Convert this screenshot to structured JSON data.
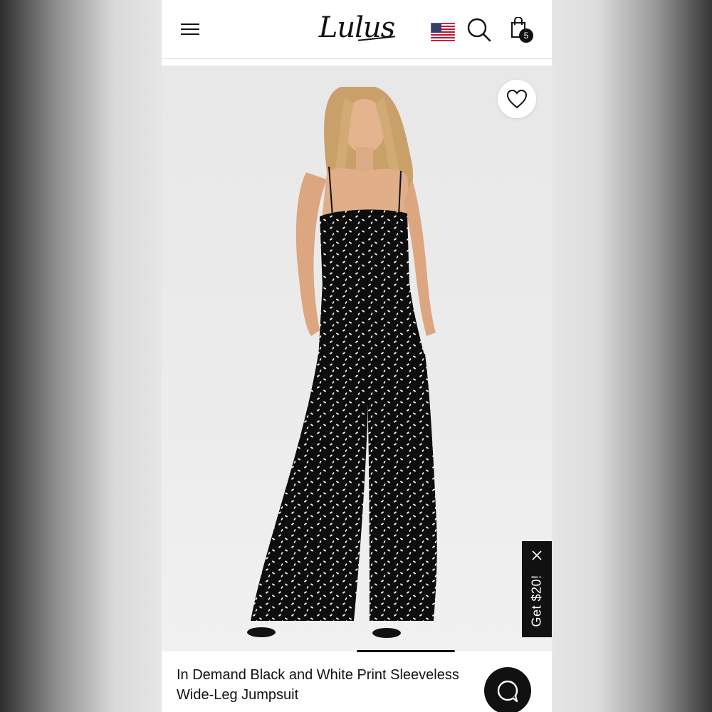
{
  "header": {
    "brand": "Lulus",
    "cart_count": "5"
  },
  "product": {
    "title_line1": "In Demand Black and White Print Sleeveless",
    "title_line2": "Wide-Leg Jumpsuit"
  },
  "promo": {
    "label": "Get $20!"
  },
  "icons": [
    "menu-icon",
    "us-flag-icon",
    "search-icon",
    "shopping-bag-icon",
    "heart-icon",
    "close-icon",
    "chat-icon"
  ],
  "colors": {
    "brand_dark": "#111111",
    "background": "#ffffff",
    "photo_bg": "#ebebeb"
  }
}
